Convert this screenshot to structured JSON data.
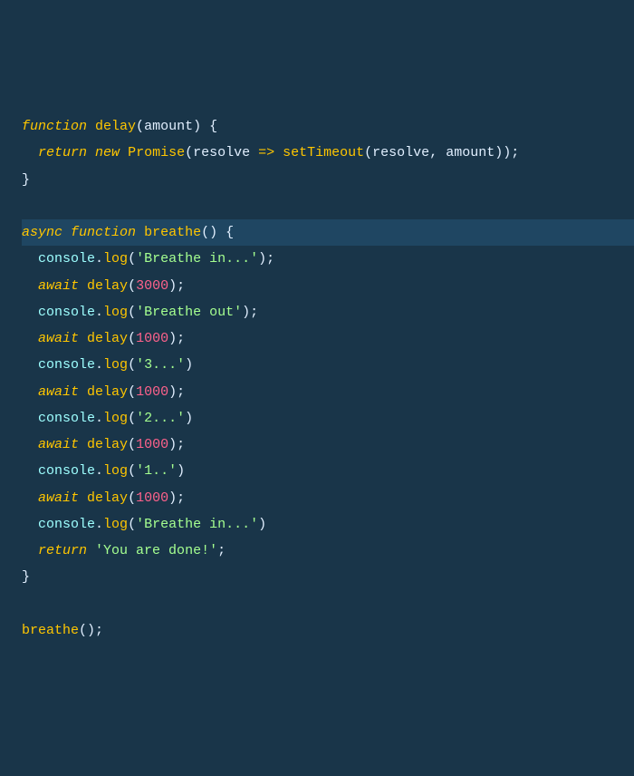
{
  "code": {
    "line1": {
      "kw_function": "function",
      "name": "delay",
      "po": "(",
      "param": "amount",
      "pc": ")",
      "ob": " {"
    },
    "line2": {
      "indent": "  ",
      "kw_return": "return",
      "sp1": " ",
      "kw_new": "new",
      "sp2": " ",
      "promise": "Promise",
      "po1": "(",
      "resolve": "resolve",
      "arrow": " => ",
      "settimeout": "setTimeout",
      "po2": "(",
      "resolve2": "resolve",
      "comma": ", ",
      "amount": "amount",
      "pc1": ")",
      "pc2": ")",
      "semi": ";"
    },
    "line3": {
      "cb": "}"
    },
    "line4": {
      "blank": ""
    },
    "line5": {
      "kw_async": "async",
      "sp": " ",
      "kw_function": "function",
      "sp2": " ",
      "name": "breathe",
      "po": "(",
      "pc": ")",
      "ob": " {"
    },
    "line6": {
      "indent": "  ",
      "console": "console",
      "dot": ".",
      "log": "log",
      "po": "(",
      "str": "'Breathe in...'",
      "pc": ")",
      "semi": ";"
    },
    "line7": {
      "indent": "  ",
      "kw_await": "await",
      "sp": " ",
      "fn": "delay",
      "po": "(",
      "num": "3000",
      "pc": ")",
      "semi": ";"
    },
    "line8": {
      "indent": "  ",
      "console": "console",
      "dot": ".",
      "log": "log",
      "po": "(",
      "str": "'Breathe out'",
      "pc": ")",
      "semi": ";"
    },
    "line9": {
      "indent": "  ",
      "kw_await": "await",
      "sp": " ",
      "fn": "delay",
      "po": "(",
      "num": "1000",
      "pc": ")",
      "semi": ";"
    },
    "line10": {
      "indent": "  ",
      "console": "console",
      "dot": ".",
      "log": "log",
      "po": "(",
      "str": "'3...'",
      "pc": ")"
    },
    "line11": {
      "indent": "  ",
      "kw_await": "await",
      "sp": " ",
      "fn": "delay",
      "po": "(",
      "num": "1000",
      "pc": ")",
      "semi": ";"
    },
    "line12": {
      "indent": "  ",
      "console": "console",
      "dot": ".",
      "log": "log",
      "po": "(",
      "str": "'2...'",
      "pc": ")"
    },
    "line13": {
      "indent": "  ",
      "kw_await": "await",
      "sp": " ",
      "fn": "delay",
      "po": "(",
      "num": "1000",
      "pc": ")",
      "semi": ";"
    },
    "line14": {
      "indent": "  ",
      "console": "console",
      "dot": ".",
      "log": "log",
      "po": "(",
      "str": "'1..'",
      "pc": ")"
    },
    "line15": {
      "indent": "  ",
      "kw_await": "await",
      "sp": " ",
      "fn": "delay",
      "po": "(",
      "num": "1000",
      "pc": ")",
      "semi": ";"
    },
    "line16": {
      "indent": "  ",
      "console": "console",
      "dot": ".",
      "log": "log",
      "po": "(",
      "str": "'Breathe in...'",
      "pc": ")"
    },
    "line17": {
      "indent": "  ",
      "kw_return": "return",
      "sp": " ",
      "str": "'You are done!'",
      "semi": ";"
    },
    "line18": {
      "cb": "}"
    },
    "line19": {
      "blank": ""
    },
    "line20": {
      "fn": "breathe",
      "po": "(",
      "pc": ")",
      "semi": ";"
    }
  }
}
